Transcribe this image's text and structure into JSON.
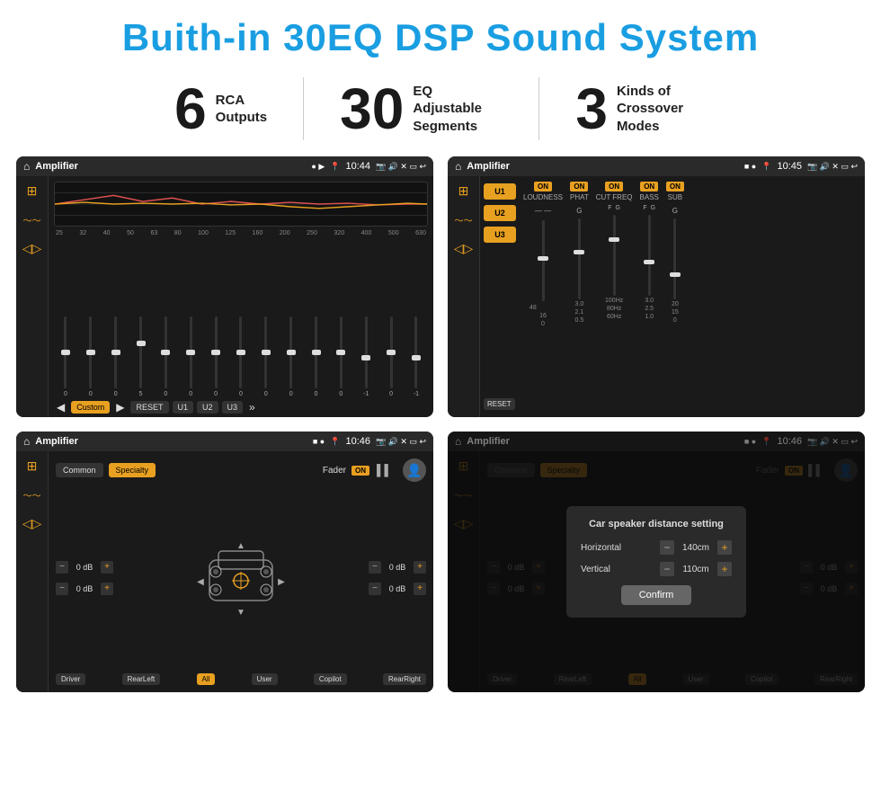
{
  "page": {
    "title": "Buith-in 30EQ DSP Sound System",
    "stats": [
      {
        "number": "6",
        "label": "RCA\nOutputs"
      },
      {
        "number": "30",
        "label": "EQ Adjustable\nSegments"
      },
      {
        "number": "3",
        "label": "Kinds of\nCrossover Modes"
      }
    ]
  },
  "screen1": {
    "status": {
      "title": "Amplifier",
      "time": "10:44"
    },
    "freqs": [
      "25",
      "32",
      "40",
      "50",
      "63",
      "80",
      "100",
      "125",
      "160",
      "200",
      "250",
      "320",
      "400",
      "500",
      "630"
    ],
    "values": [
      "0",
      "0",
      "0",
      "5",
      "0",
      "0",
      "0",
      "0",
      "0",
      "0",
      "0",
      "0",
      "-1",
      "0",
      "-1"
    ],
    "buttons": [
      "Custom",
      "RESET",
      "U1",
      "U2",
      "U3"
    ]
  },
  "screen2": {
    "status": {
      "title": "Amplifier",
      "time": "10:45"
    },
    "presets": [
      "U1",
      "U2",
      "U3"
    ],
    "controls": [
      "LOUDNESS",
      "PHAT",
      "CUT FREQ",
      "BASS",
      "SUB"
    ],
    "resetLabel": "RESET"
  },
  "screen3": {
    "status": {
      "title": "Amplifier",
      "time": "10:46"
    },
    "tabs": [
      "Common",
      "Specialty"
    ],
    "faderLabel": "Fader",
    "dbValues": [
      "0 dB",
      "0 dB",
      "0 dB",
      "0 dB"
    ],
    "buttons": [
      "Driver",
      "Copilot",
      "RearLeft",
      "All",
      "User",
      "RearRight"
    ]
  },
  "screen4": {
    "status": {
      "title": "Amplifier",
      "time": "10:46"
    },
    "tabs": [
      "Common",
      "Specialty"
    ],
    "dialog": {
      "title": "Car speaker distance setting",
      "horizontal": {
        "label": "Horizontal",
        "value": "140cm"
      },
      "vertical": {
        "label": "Vertical",
        "value": "110cm"
      },
      "confirmLabel": "Confirm"
    },
    "dbValues": [
      "0 dB",
      "0 dB"
    ],
    "buttons": [
      "Driver",
      "Copilot",
      "RearLeft",
      "All",
      "User",
      "RearRight"
    ]
  },
  "colors": {
    "accent": "#e8a020",
    "brand": "#1a9ee2",
    "dark": "#1a1a1a",
    "panel": "#2a2a2a"
  }
}
